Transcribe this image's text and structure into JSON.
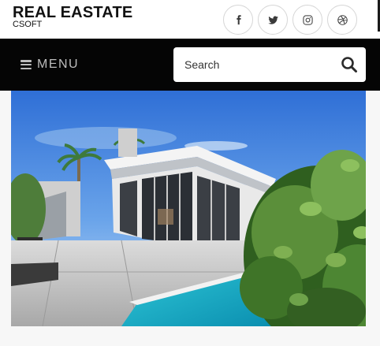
{
  "header": {
    "brand_title": "REAL EASTATE",
    "brand_subtitle": "CSOFT"
  },
  "social": [
    {
      "name": "facebook",
      "icon": "facebook-icon"
    },
    {
      "name": "twitter",
      "icon": "twitter-icon"
    },
    {
      "name": "instagram",
      "icon": "instagram-icon"
    },
    {
      "name": "dribbble",
      "icon": "dribbble-icon"
    }
  ],
  "nav": {
    "menu_label": "MENU",
    "search_placeholder": "Search",
    "search_value": ""
  },
  "hero": {
    "image": "modern-house-with-pool-photo"
  },
  "colors": {
    "navbar_bg": "#050505",
    "menu_text": "#bdbdbd"
  }
}
